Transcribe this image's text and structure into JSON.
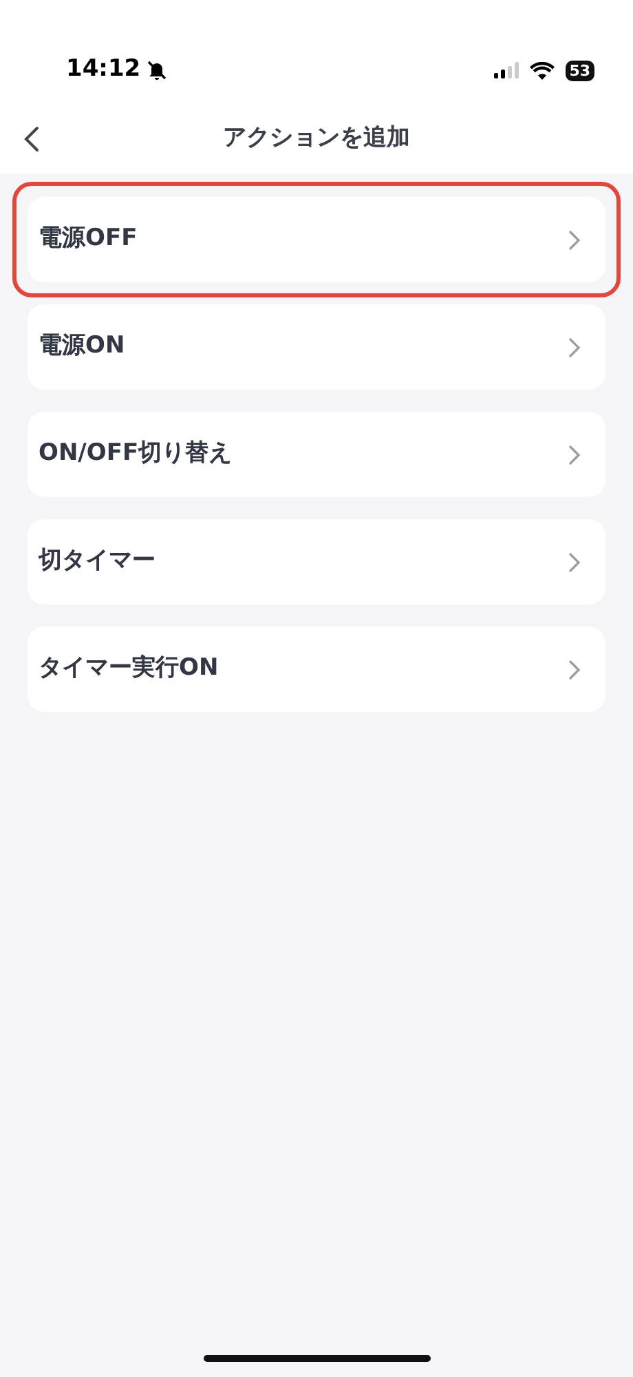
{
  "status_bar": {
    "time": "14:12",
    "battery": "53"
  },
  "nav": {
    "title": "アクションを追加"
  },
  "items": [
    {
      "label": "電源OFF",
      "highlighted": true
    },
    {
      "label": "電源ON",
      "highlighted": false
    },
    {
      "label": "ON/OFF切り替え",
      "highlighted": false
    },
    {
      "label": "切タイマー",
      "highlighted": false
    },
    {
      "label": "タイマー実行ON",
      "highlighted": false
    }
  ]
}
